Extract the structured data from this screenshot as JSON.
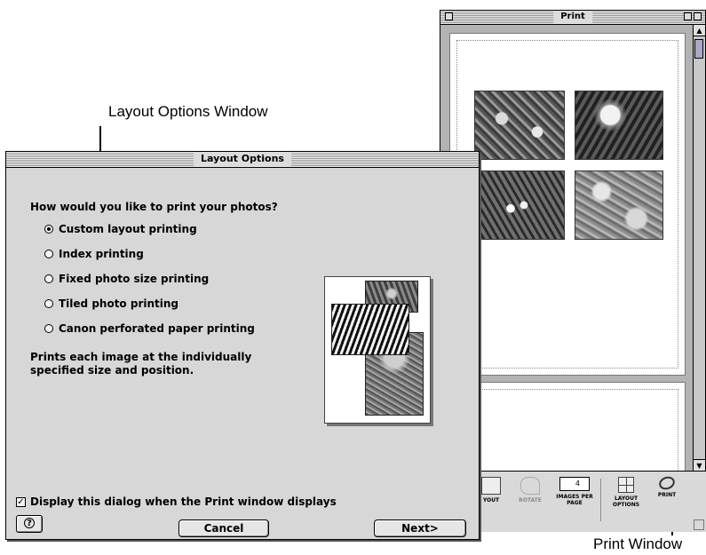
{
  "callouts": {
    "layout_options_window": "Layout Options Window",
    "print_window": "Print Window"
  },
  "print_window": {
    "title": "Print",
    "toolbar": [
      {
        "name": "layout",
        "label": "YOUT",
        "enabled": true,
        "icon": "layout-icon"
      },
      {
        "name": "rotate",
        "label": "ROTATE",
        "enabled": false,
        "icon": "rotate-icon"
      },
      {
        "name": "images-per-page",
        "label": "IMAGES PER PAGE",
        "enabled": true,
        "icon": "images-per-page-stepper-icon",
        "value": "4"
      },
      {
        "name": "layout-options",
        "label": "LAYOUT OPTIONS",
        "enabled": true,
        "icon": "layout-options-icon"
      },
      {
        "name": "print",
        "label": "PRINT",
        "enabled": true,
        "icon": "printer-icon"
      }
    ]
  },
  "layout_dialog": {
    "title": "Layout Options",
    "question": "How would you like to print your photos?",
    "options": [
      {
        "label": "Custom layout printing",
        "selected": true
      },
      {
        "label": "Index printing",
        "selected": false
      },
      {
        "label": "Fixed photo size printing",
        "selected": false
      },
      {
        "label": "Tiled photo printing",
        "selected": false
      },
      {
        "label": "Canon perforated paper printing",
        "selected": false
      }
    ],
    "description_line1": "Prints each image at the individually",
    "description_line2": "specified size and position.",
    "checkbox_label": "Display this dialog when the Print window displays",
    "checkbox_checked": true,
    "help_icon": "question-mark-icon",
    "cancel_label": "Cancel",
    "next_label": "Next>"
  }
}
